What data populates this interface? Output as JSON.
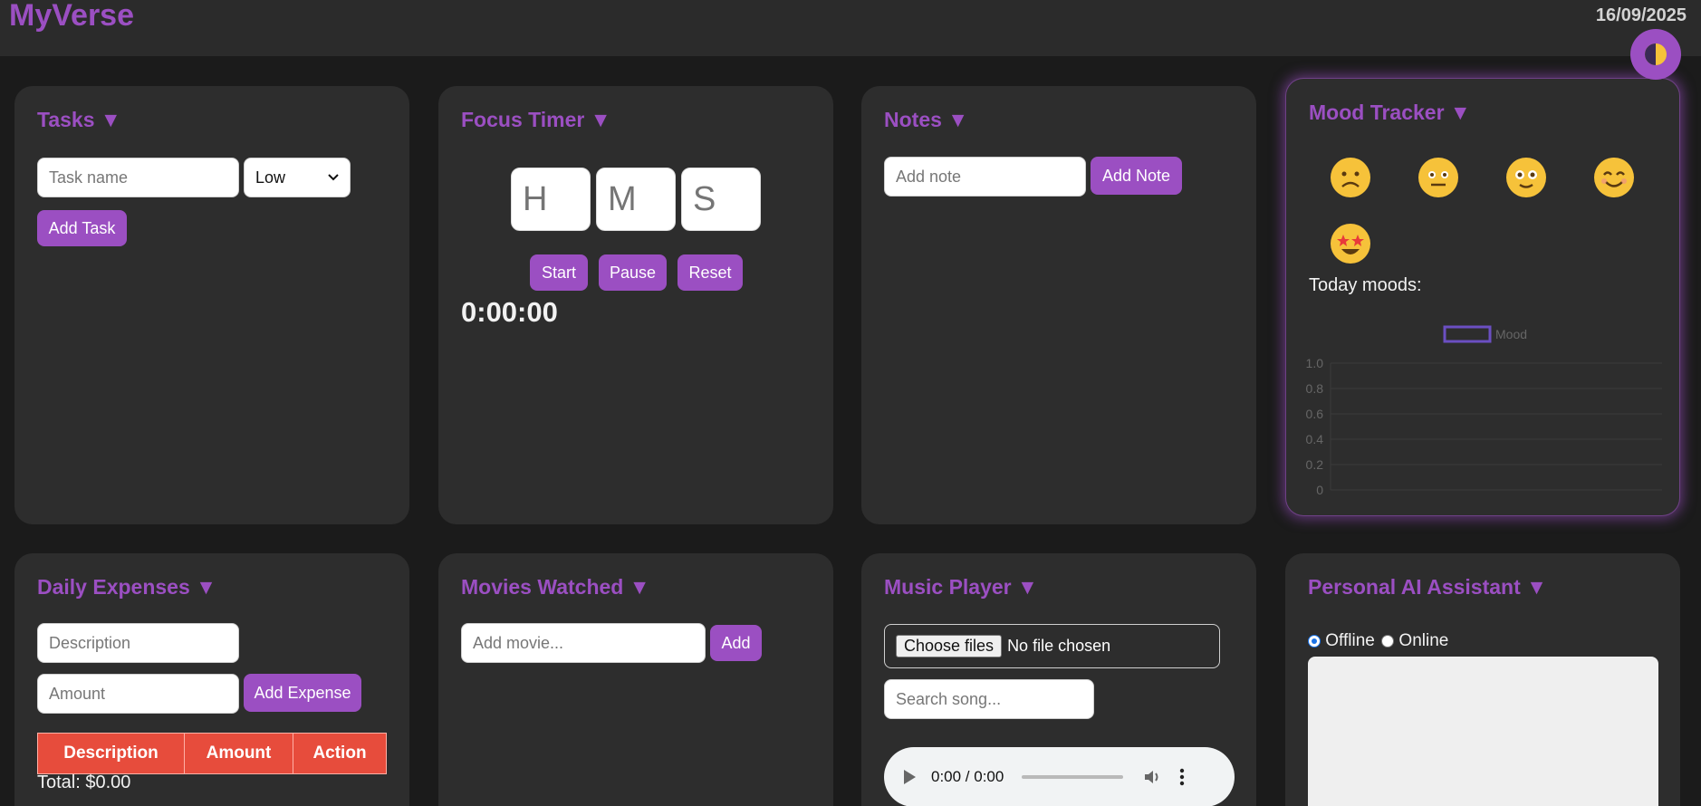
{
  "header": {
    "brand": "MyVerse",
    "date": "16/09/2025"
  },
  "colors": {
    "accent": "#9b4fc2",
    "card": "#2d2d2d",
    "background": "#1b1b1b",
    "table_header": "#e74c3c"
  },
  "tasks": {
    "title": "Tasks ▼",
    "name_placeholder": "Task name",
    "priority_selected": "Low",
    "add_label": "Add Task"
  },
  "focus_timer": {
    "title": "Focus Timer ▼",
    "hours_placeholder": "H",
    "minutes_placeholder": "M",
    "seconds_placeholder": "S",
    "start_label": "Start",
    "pause_label": "Pause",
    "reset_label": "Reset",
    "display": "0:00:00"
  },
  "notes": {
    "title": "Notes ▼",
    "placeholder": "Add note",
    "add_label": "Add Note"
  },
  "mood": {
    "title": "Mood Tracker ▼",
    "emojis": [
      "sad-face-icon",
      "neutral-face-icon",
      "flushed-face-icon",
      "smiling-face-icon",
      "star-struck-face-icon"
    ],
    "today_label": "Today moods:"
  },
  "chart_data": {
    "type": "line",
    "series": [
      {
        "name": "Mood",
        "values": []
      }
    ],
    "ylim": [
      0,
      1
    ],
    "yticks": [
      "1.0",
      "0.8",
      "0.6",
      "0.4",
      "0.2",
      "0"
    ],
    "legend": "top-center",
    "grid": true
  },
  "expenses": {
    "title": "Daily Expenses ▼",
    "description_placeholder": "Description",
    "amount_placeholder": "Amount",
    "add_label": "Add Expense",
    "columns": [
      "Description",
      "Amount",
      "Action"
    ],
    "total": "Total: $0.00"
  },
  "movies": {
    "title": "Movies Watched ▼",
    "placeholder": "Add movie...",
    "add_label": "Add"
  },
  "music": {
    "title": "Music Player ▼",
    "choose_label": "Choose files",
    "file_status": "No file chosen",
    "search_placeholder": "Search song...",
    "time": "0:00 / 0:00"
  },
  "assistant": {
    "title": "Personal AI Assistant ▼",
    "mode_offline": "Offline",
    "mode_online": "Online",
    "selected_mode": "Offline"
  }
}
